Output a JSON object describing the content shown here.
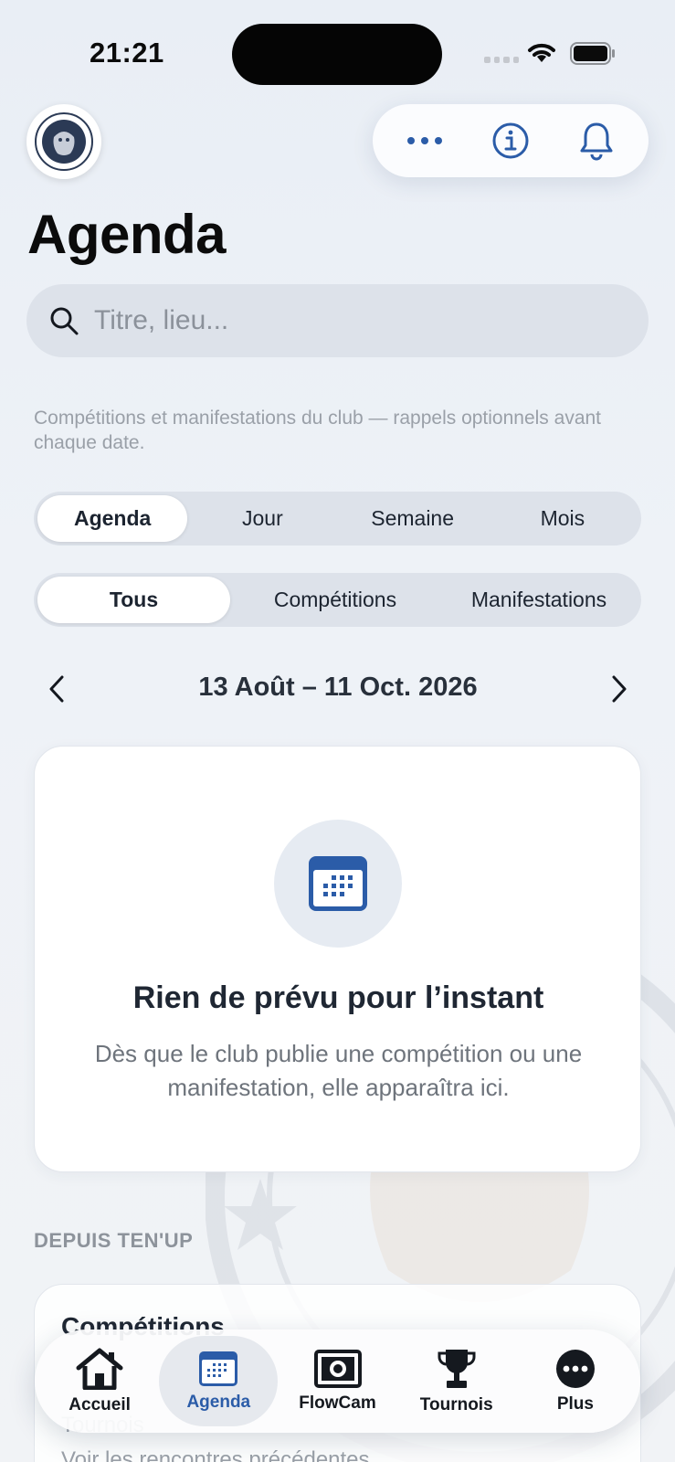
{
  "status_bar": {
    "time": "21:21"
  },
  "header": {
    "title": "Agenda",
    "actions": [
      "more-icon",
      "info-icon",
      "bell-icon"
    ]
  },
  "search": {
    "placeholder": "Titre, lieu..."
  },
  "subtitle": "Compétitions et manifestations du club — rappels optionnels avant chaque date.",
  "view_tabs": {
    "items": [
      "Agenda",
      "Jour",
      "Semaine",
      "Mois"
    ],
    "selected": "Agenda"
  },
  "filter_tabs": {
    "items": [
      "Tous",
      "Compétitions",
      "Manifestations"
    ],
    "selected": "Tous"
  },
  "date_range": {
    "label": "13 Août – 11 Oct. 2026"
  },
  "empty_state": {
    "icon": "calendar-icon",
    "title": "Rien de prévu pour l’instant",
    "body": "Dès que le club publie une compétition ou une manifestation, elle apparaîtra ici."
  },
  "tenup_section": {
    "label": "DEPUIS TEN'UP",
    "card": {
      "title": "Compétitions",
      "line1": "Tournois",
      "line2": "Voir les rencontres précédentes"
    }
  },
  "tab_bar": {
    "items": [
      {
        "label": "Accueil",
        "icon": "home-icon"
      },
      {
        "label": "Agenda",
        "icon": "calendar-icon"
      },
      {
        "label": "FlowCam",
        "icon": "camera-icon"
      },
      {
        "label": "Tournois",
        "icon": "trophy-icon"
      },
      {
        "label": "Plus",
        "icon": "more-icon"
      }
    ],
    "selected": "Agenda"
  },
  "colors": {
    "accent": "#2b5ca8",
    "background": "#eef2f7",
    "card": "#ffffff"
  }
}
